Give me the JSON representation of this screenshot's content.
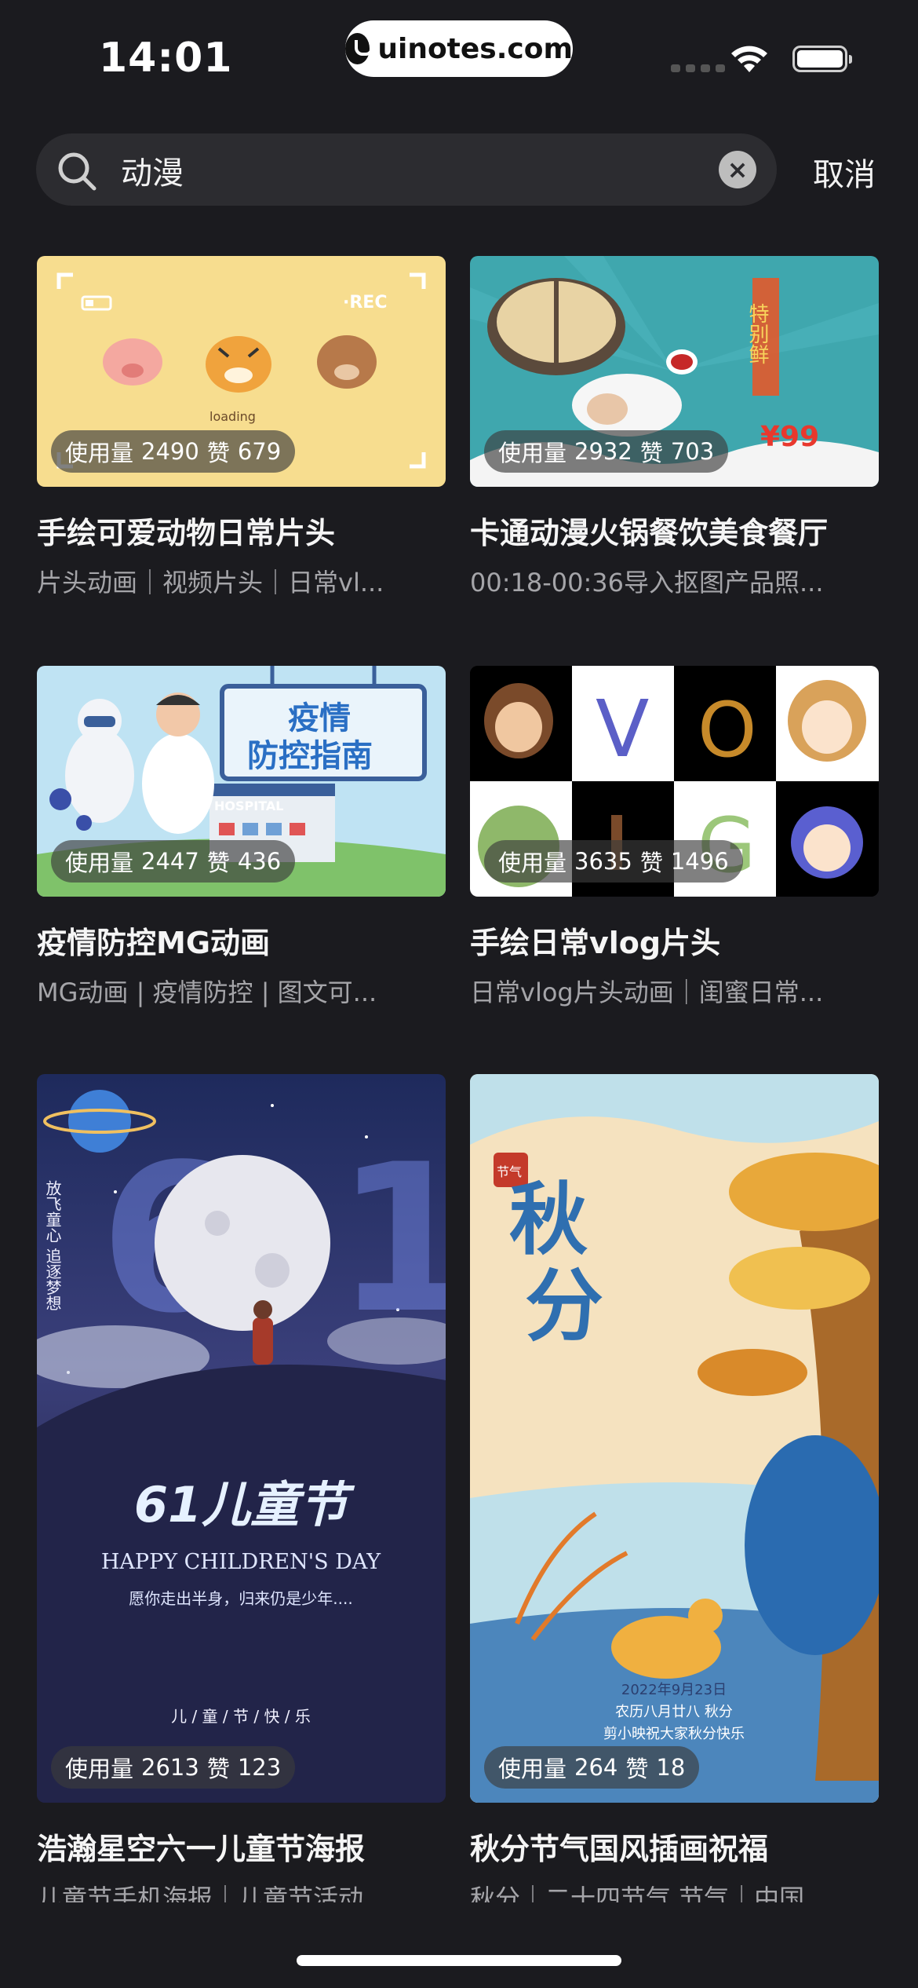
{
  "status_bar": {
    "time": "14:01",
    "url": "uinotes.com"
  },
  "search": {
    "query": "动漫",
    "cancel_label": "取消"
  },
  "cards": [
    {
      "title": "手绘可爱动物日常片头",
      "tags": "片头动画｜视频片头｜日常vl...",
      "usage_label": "使用量",
      "usage": "2490",
      "likes_label": "赞",
      "likes": "679",
      "thumb_text": {
        "rec": "·REC",
        "loading": "loading"
      }
    },
    {
      "title": "卡通动漫火锅餐饮美食餐厅",
      "tags": "00:18-00:36导入抠图产品照...",
      "usage_label": "使用量",
      "usage": "2932",
      "likes_label": "赞",
      "likes": "703",
      "thumb_text": {
        "banner": "特别鲜",
        "price": "¥99"
      }
    },
    {
      "title": "疫情防控MG动画",
      "tags": "MG动画 | 疫情防控 | 图文可...",
      "usage_label": "使用量",
      "usage": "2447",
      "likes_label": "赞",
      "likes": "436",
      "thumb_text": {
        "sign_line1": "疫情",
        "sign_line2": "防控指南",
        "hospital": "HOSPITAL"
      }
    },
    {
      "title": "手绘日常vlog片头",
      "tags": "日常vlog片头动画｜闺蜜日常...",
      "usage_label": "使用量",
      "usage": "3635",
      "likes_label": "赞",
      "likes": "1496",
      "thumb_text": {
        "v": "V",
        "o": "O",
        "g": "G"
      }
    },
    {
      "title": "浩瀚星空六一儿童节海报",
      "tags": "儿童节手机海报｜儿童节活动",
      "usage_label": "使用量",
      "usage": "2613",
      "likes_label": "赞",
      "likes": "123",
      "thumb_text": {
        "big": "61儿童节",
        "english": "HAPPY CHILDREN'S DAY",
        "sub": "愿你走出半身，归来仍是少年....",
        "side": "放飞童心 追逐梦想",
        "bottom": "儿 / 童 / 节 / 快 / 乐"
      }
    },
    {
      "title": "秋分节气国风插画祝福",
      "tags": "秋分｜二十四节气 节气｜中国",
      "usage_label": "使用量",
      "usage": "264",
      "likes_label": "赞",
      "likes": "18",
      "thumb_text": {
        "big1": "秋",
        "big2": "分",
        "stamp": "节气",
        "date": "2022年9月23日",
        "lunar": "农历八月廿八 秋分",
        "wish": "剪小映祝大家秋分快乐"
      }
    }
  ],
  "colors": {
    "background": "#1b1b1f",
    "search_bg": "#2c2c30",
    "subtext": "#a5a5a9"
  }
}
